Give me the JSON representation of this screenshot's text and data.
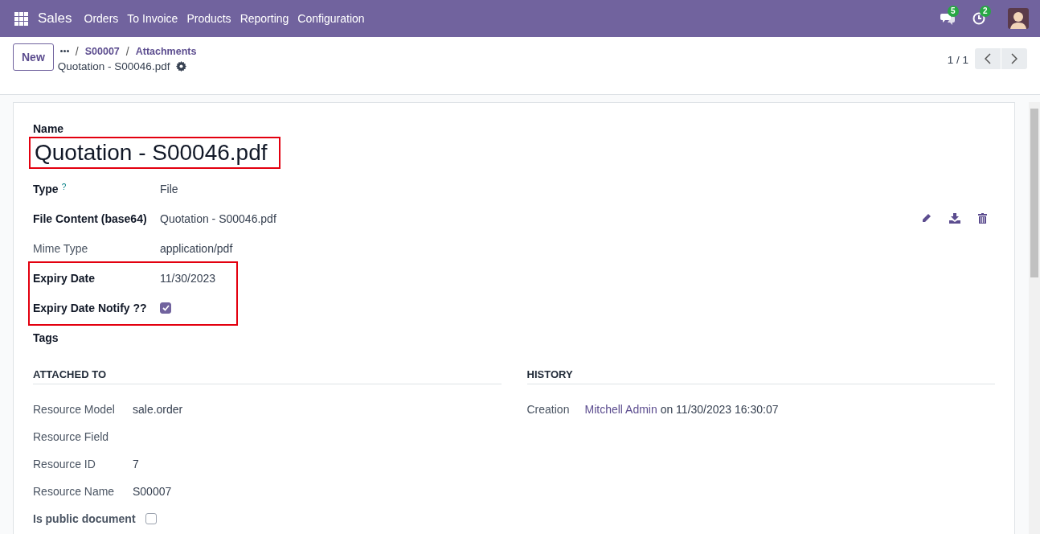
{
  "navbar": {
    "app": "Sales",
    "menu": [
      "Orders",
      "To Invoice",
      "Products",
      "Reporting",
      "Configuration"
    ],
    "messages_badge": "5",
    "activities_badge": "2"
  },
  "control_panel": {
    "new_button": "New",
    "separator": "/",
    "breadcrumbs": [
      "S00007",
      "Attachments"
    ],
    "record_title": "Quotation - S00046.pdf",
    "pager": "1 / 1"
  },
  "form": {
    "name_label": "Name",
    "name_value": "Quotation - S00046.pdf",
    "name_highlighted": true,
    "field_groups": [
      {
        "highlighted": false,
        "fields": [
          {
            "kind": "text",
            "label": "Type",
            "help": "?",
            "bold": true,
            "value": "File"
          },
          {
            "kind": "file",
            "label": "File Content (base64)",
            "bold": true,
            "value": "Quotation - S00046.pdf"
          },
          {
            "kind": "text",
            "label": "Mime Type",
            "bold": false,
            "value": "application/pdf"
          }
        ]
      },
      {
        "highlighted": true,
        "fields": [
          {
            "kind": "text",
            "label": "Expiry Date",
            "bold": true,
            "value": "11/30/2023"
          },
          {
            "kind": "checkbox",
            "label": "Expiry Date Notify ??",
            "bold": true,
            "checked": true
          }
        ]
      },
      {
        "highlighted": false,
        "fields": [
          {
            "kind": "text",
            "label": "Tags",
            "bold": true
          }
        ]
      }
    ],
    "attached_to": {
      "title": "ATTACHED TO",
      "fields": [
        {
          "kind": "text",
          "label": "Resource Model",
          "bold": false,
          "value": "sale.order"
        },
        {
          "kind": "text",
          "label": "Resource Field",
          "bold": false
        },
        {
          "kind": "text",
          "label": "Resource ID",
          "bold": false,
          "value": "7"
        },
        {
          "kind": "text",
          "label": "Resource Name",
          "bold": false,
          "value": "S00007"
        },
        {
          "kind": "checkbox",
          "label": "Is public document",
          "bold": true,
          "checked": false
        }
      ]
    },
    "history": {
      "title": "HISTORY",
      "label": "Creation",
      "user": "Mitchell Admin",
      "rest": "on 11/30/2023 16:30:07"
    }
  }
}
